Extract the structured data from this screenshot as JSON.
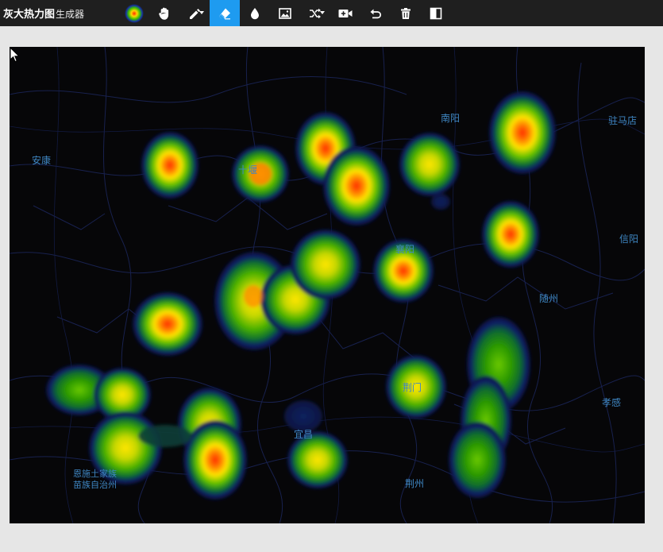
{
  "app": {
    "title_bold": "灰大热力图",
    "title_light": "生成器"
  },
  "toolbar": {
    "tools": [
      {
        "icon": "heat-gradient-icon",
        "active": false
      },
      {
        "icon": "hand-pan-icon",
        "active": false
      },
      {
        "icon": "pencil-icon",
        "active": false,
        "dropdown": true
      },
      {
        "icon": "eraser-icon",
        "active": true
      },
      {
        "icon": "droplet-icon",
        "active": false
      },
      {
        "icon": "image-icon",
        "active": false
      },
      {
        "icon": "shuffle-icon",
        "active": false,
        "dropdown": true
      },
      {
        "icon": "add-video-icon",
        "active": false
      },
      {
        "icon": "undo-icon",
        "active": false
      },
      {
        "icon": "trash-icon",
        "active": false
      },
      {
        "icon": "split-panel-icon",
        "active": false
      }
    ],
    "active_color": "#1e9bf0"
  },
  "map": {
    "background": "#060608",
    "city_color": "#3f87c4",
    "cities": {
      "ankang": "安康",
      "shiyan": "十堰",
      "nanyang": "南阳",
      "zhumadian": "驻马店",
      "xiangyang": "襄阳",
      "xinyang": "信阳",
      "suizhou": "随州",
      "jingmen": "荆门",
      "xiaogan": "孝感",
      "yichang": "宜昌",
      "jingzhou": "荆州",
      "enshi_line1": "恩施土家族",
      "enshi_line2": "苗族自治州"
    }
  }
}
